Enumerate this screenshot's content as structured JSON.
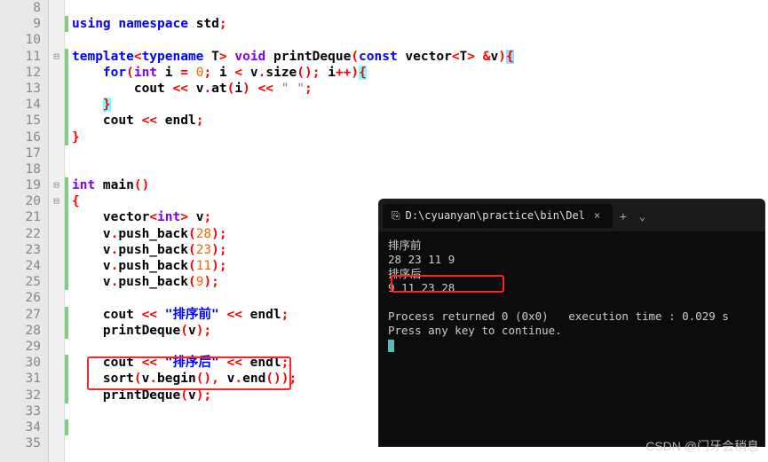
{
  "gutter": [
    "8",
    "9",
    "10",
    "11",
    "12",
    "13",
    "14",
    "15",
    "16",
    "17",
    "18",
    "19",
    "20",
    "21",
    "22",
    "23",
    "24",
    "25",
    "26",
    "27",
    "28",
    "29",
    "30",
    "31",
    "32",
    "33",
    "34",
    "35"
  ],
  "fold": [
    "",
    "",
    "",
    "⊟",
    "",
    "",
    "",
    "",
    "",
    "",
    "",
    "⊟",
    "⊟",
    "",
    "",
    "",
    "",
    "",
    "",
    "",
    "",
    "",
    "",
    "",
    "",
    "",
    "",
    ""
  ],
  "mod": [
    false,
    true,
    false,
    true,
    true,
    true,
    true,
    true,
    true,
    false,
    false,
    true,
    true,
    true,
    true,
    true,
    true,
    true,
    false,
    true,
    true,
    false,
    true,
    true,
    true,
    false,
    true,
    false
  ],
  "code": {
    "l9a": "using",
    "l9b": " ",
    "l9c": "namespace",
    "l9d": " std",
    "l9e": ";",
    "l11a": "template",
    "l11b": "<",
    "l11c": "typename",
    "l11d": " T",
    "l11e": ">",
    "l11f": " ",
    "l11g": "void",
    "l11h": " printDeque",
    "l11i": "(",
    "l11j": "const",
    "l11k": " vector",
    "l11l": "<",
    "l11m": "T",
    "l11n": ">",
    "l11o": " ",
    "l11p": "&",
    "l11q": "v",
    "l11r": ")",
    "l11s": "{",
    "l12a": "    ",
    "l12b": "for",
    "l12c": "(",
    "l12d": "int",
    "l12e": " i ",
    "l12f": "=",
    "l12g": " ",
    "l12h": "0",
    "l12i": ";",
    "l12j": " i ",
    "l12k": "<",
    "l12l": " v",
    "l12m": ".",
    "l12n": "size",
    "l12o": "();",
    "l12p": " i",
    "l12q": "++",
    "l12r": ")",
    "l12s": "{",
    "l13a": "        cout ",
    "l13b": "<<",
    "l13c": " v",
    "l13d": ".",
    "l13e": "at",
    "l13f": "(",
    "l13g": "i",
    "l13h": ")",
    "l13i": " ",
    "l13j": "<<",
    "l13k": " ",
    "l13l": "\" \"",
    "l13m": ";",
    "l14a": "    ",
    "l14b": "}",
    "l15a": "    cout ",
    "l15b": "<<",
    "l15c": " endl",
    "l15d": ";",
    "l16a": "}",
    "l19a": "int",
    "l19b": " main",
    "l19c": "()",
    "l20a": "{",
    "l21a": "    vector",
    "l21b": "<",
    "l21c": "int",
    "l21d": ">",
    "l21e": " v",
    "l21f": ";",
    "l22a": "    v",
    "l22b": ".",
    "l22c": "push_back",
    "l22d": "(",
    "l22e": "28",
    "l22f": ");",
    "l23a": "    v",
    "l23b": ".",
    "l23c": "push_back",
    "l23d": "(",
    "l23e": "23",
    "l23f": ");",
    "l24a": "    v",
    "l24b": ".",
    "l24c": "push_back",
    "l24d": "(",
    "l24e": "11",
    "l24f": ");",
    "l25a": "    v",
    "l25b": ".",
    "l25c": "push_back",
    "l25d": "(",
    "l25e": "9",
    "l25f": ");",
    "l27a": "    cout ",
    "l27b": "<<",
    "l27c": " ",
    "l27d": "\"排序前\"",
    "l27e": " ",
    "l27f": "<<",
    "l27g": " endl",
    "l27h": ";",
    "l28a": "    printDeque",
    "l28b": "(",
    "l28c": "v",
    "l28d": ");",
    "l30a": "    cout ",
    "l30b": "<<",
    "l30c": " ",
    "l30d": "\"排序后\"",
    "l30e": " ",
    "l30f": "<<",
    "l30g": " endl",
    "l30h": ";",
    "l31a": "    sort",
    "l31b": "(",
    "l31c": "v",
    "l31d": ".",
    "l31e": "begin",
    "l31f": "(),",
    "l31g": " v",
    "l31h": ".",
    "l31i": "end",
    "l31j": "());",
    "l32a": "    printDeque",
    "l32b": "(",
    "l32c": "v",
    "l32d": ");"
  },
  "terminal": {
    "tab_icon": "⎘",
    "tab_title": "D:\\cyuanyan\\practice\\bin\\Del",
    "close": "×",
    "plus": "+",
    "chev": "⌄",
    "line1": "排序前",
    "line2": "28 23 11 9",
    "line3": "排序后",
    "line4": "9 11 23 28",
    "blank": "",
    "line5": "Process returned 0 (0x0)   execution time : 0.029 s",
    "line6": "Press any key to continue."
  },
  "watermark": "CSDN @门牙会稍息"
}
